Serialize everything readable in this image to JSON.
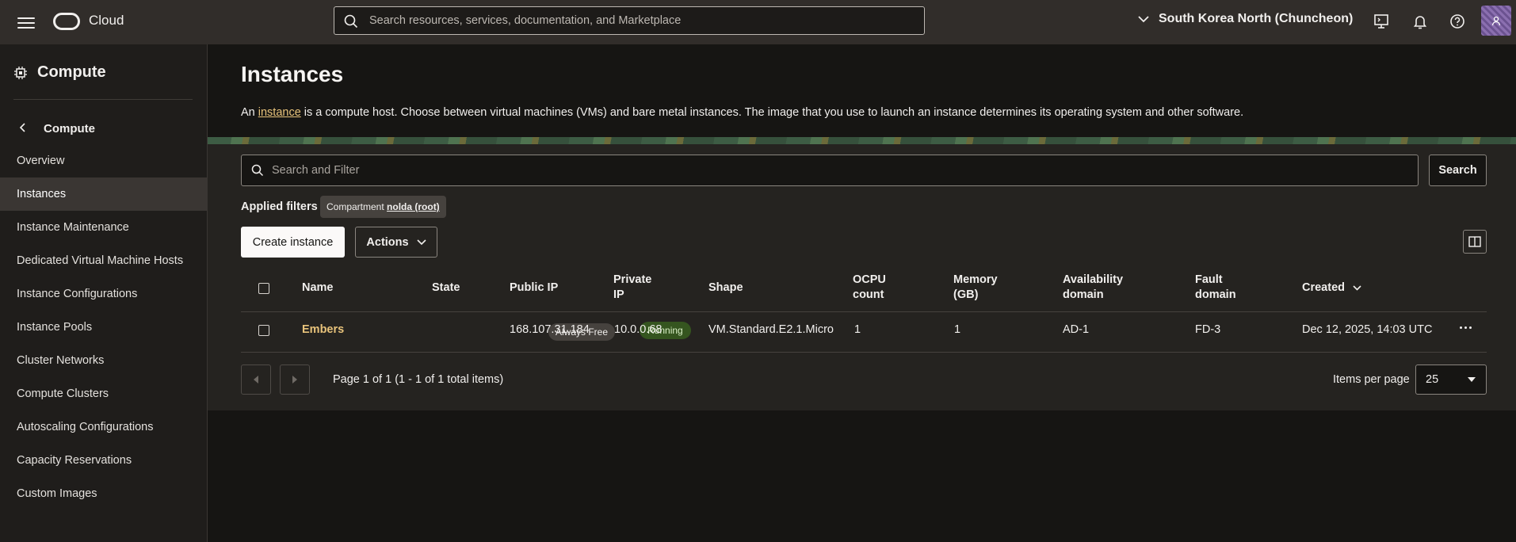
{
  "topbar": {
    "brand": "Cloud",
    "search_placeholder": "Search resources, services, documentation, and Marketplace",
    "region": "South Korea North (Chuncheon)"
  },
  "sidebar": {
    "title": "Compute",
    "back_label": "Compute",
    "items": [
      {
        "label": "Overview"
      },
      {
        "label": "Instances"
      },
      {
        "label": "Instance Maintenance"
      },
      {
        "label": "Dedicated Virtual Machine Hosts"
      },
      {
        "label": "Instance Configurations"
      },
      {
        "label": "Instance Pools"
      },
      {
        "label": "Cluster Networks"
      },
      {
        "label": "Compute Clusters"
      },
      {
        "label": "Autoscaling Configurations"
      },
      {
        "label": "Capacity Reservations"
      },
      {
        "label": "Custom Images"
      }
    ],
    "active_item": "Instances"
  },
  "main": {
    "title": "Instances",
    "intro_before": "An ",
    "intro_link": "instance",
    "intro_after": " is a compute host. Choose between virtual machines (VMs) and bare metal instances. The image that you use to launch an instance determines its operating system and other software.",
    "filter_placeholder": "Search and Filter",
    "search_button": "Search",
    "applied_filters_label": "Applied filters",
    "filter_chip_prefix": "Compartment ",
    "filter_chip_value": "nolda (root)",
    "create_button": "Create instance",
    "actions_button": "Actions"
  },
  "table": {
    "headers": {
      "name": "Name",
      "state": "State",
      "public_ip": "Public IP",
      "private_ip_1": "Private",
      "private_ip_2": "IP",
      "shape": "Shape",
      "ocpu_1": "OCPU",
      "ocpu_2": "count",
      "memory_1": "Memory",
      "memory_2": "(GB)",
      "avail_1": "Availability",
      "avail_2": "domain",
      "fault_1": "Fault",
      "fault_2": "domain",
      "created": "Created"
    },
    "rows": [
      {
        "name": "Embers",
        "badge": "Always Free",
        "state": "Running",
        "public_ip": "168.107.31.184",
        "private_ip": "10.0.0.68",
        "shape": "VM.Standard.E2.1.Micro",
        "ocpu": "1",
        "memory": "1",
        "availability_domain": "AD-1",
        "fault_domain": "FD-3",
        "created": "Dec 12, 2025, 14:03 UTC"
      }
    ]
  },
  "pagination": {
    "summary": "Page 1 of 1 (1 - 1 of 1 total items)",
    "items_per_page_label": "Items per page",
    "items_per_page": "25"
  },
  "colors": {
    "accent_link": "#e8c37b",
    "running_badge": "#35551f",
    "topbar": "#312d2a"
  }
}
